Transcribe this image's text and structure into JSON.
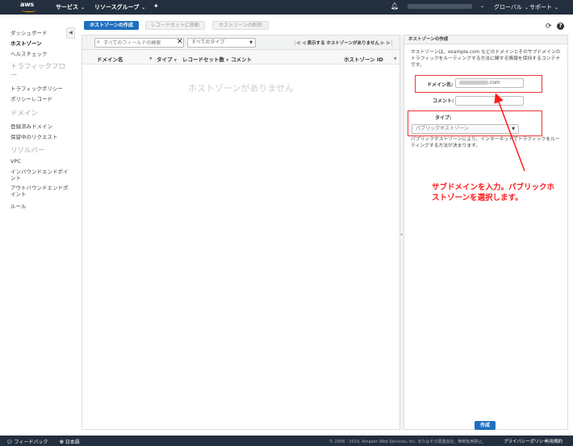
{
  "topnav": {
    "logo": "aws",
    "services": "サービス",
    "resource_groups": "リソースグループ",
    "region": "グローバル",
    "support": "サポート"
  },
  "sidebar": {
    "items": [
      {
        "label": "ダッシュボード"
      },
      {
        "label": "ホストゾーン"
      },
      {
        "label": "ヘルスチェック"
      }
    ],
    "sections": [
      {
        "title": "トラフィックフロー",
        "items": [
          {
            "label": "トラフィックポリシー"
          },
          {
            "label": "ポリシーレコード"
          }
        ]
      },
      {
        "title": "ドメイン",
        "items": [
          {
            "label": "登録済みドメイン"
          },
          {
            "label": "保留中のリクエスト"
          }
        ]
      },
      {
        "title": "リゾルバー",
        "items": [
          {
            "label": "VPC"
          },
          {
            "label": "インバウンドエンドポイント"
          },
          {
            "label": "アウトバウンドエンドポイント"
          },
          {
            "label": "ルール"
          }
        ]
      }
    ]
  },
  "actions": {
    "create": "ホストゾーンの作成",
    "goto_records": "レコードセットに移動",
    "delete": "ホストゾーンの削除"
  },
  "table": {
    "search_placeholder": "すべてのフィールドの検索",
    "type_filter": "すべてのタイプ",
    "pager_prefix": "表示する",
    "pager_text": "ホストゾーンがありません",
    "columns": [
      "ドメイン名",
      "タイプ",
      "レコードセット数",
      "コメント",
      "ホストゾーン ID"
    ],
    "empty_message": "ホストゾーンがありません"
  },
  "create_panel": {
    "header": "ホストゾーンの作成",
    "description": "ホストゾーンは、example.com などのドメインとそのサブドメインのトラフィックをルーティングする方法に関する情報を保持するコンテナです。",
    "domain_label": "ドメイン名:",
    "domain_value_suffix": ".com",
    "comment_label": "コメント:",
    "type_label": "タイプ:",
    "type_value": "パブリックホストゾーン",
    "type_description": "パブリックホストゾーンにより、インターネットでトラフィックをルーティングする方法が決まります。",
    "create_button": "作成"
  },
  "annotation": "サブドメインを入力。パブリックホストゾーンを選択します。",
  "footer": {
    "feedback": "フィードバック",
    "language": "日本語",
    "copyright": "© 2008 - 2019, Amazon Web Services, Inc. またはその関連会社。無断転用禁止。",
    "privacy": "プライバシーポリシー",
    "terms": "利用規約"
  },
  "colors": {
    "nav_bg": "#232f3e",
    "primary": "#1f6fbf",
    "annotation": "#ff1a1a",
    "logo_accent": "#ff9900"
  }
}
